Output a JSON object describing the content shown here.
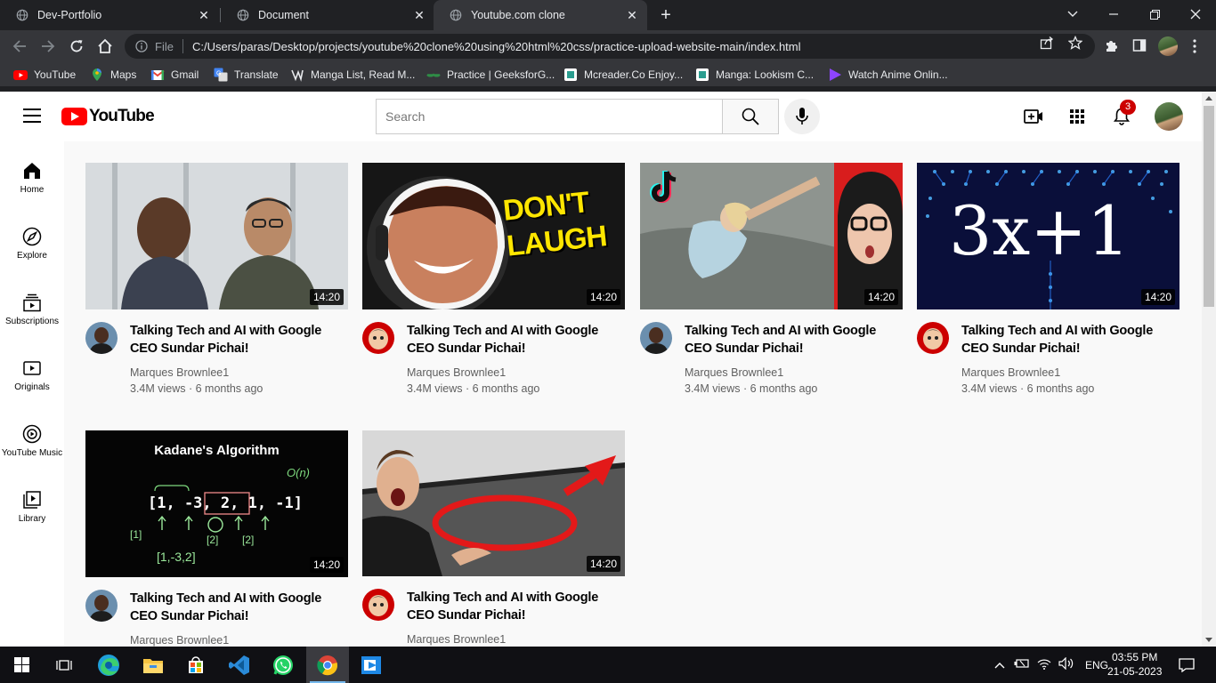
{
  "browser": {
    "tabs": [
      {
        "title": "Dev-Portfolio"
      },
      {
        "title": "Document"
      },
      {
        "title": "Youtube.com clone"
      }
    ],
    "url_label": "File",
    "url": "C:/Users/paras/Desktop/projects/youtube%20clone%20using%20html%20css/practice-upload-website-main/index.html",
    "bookmarks": [
      {
        "label": "YouTube",
        "icon": "youtube-icon"
      },
      {
        "label": "Maps",
        "icon": "maps-icon"
      },
      {
        "label": "Gmail",
        "icon": "gmail-icon"
      },
      {
        "label": "Translate",
        "icon": "translate-icon"
      },
      {
        "label": "Manga List, Read M...",
        "icon": "manga-icon"
      },
      {
        "label": "Practice | GeeksforG...",
        "icon": "gfg-icon"
      },
      {
        "label": "Mcreader.Co Enjoy...",
        "icon": "page-icon"
      },
      {
        "label": "Manga: Lookism C...",
        "icon": "page-icon"
      },
      {
        "label": "Watch Anime Onlin...",
        "icon": "anime-icon"
      }
    ]
  },
  "youtube": {
    "logo_text": "YouTube",
    "search_placeholder": "Search",
    "notification_count": "3",
    "sidebar": [
      {
        "label": "Home",
        "icon": "home-icon"
      },
      {
        "label": "Explore",
        "icon": "explore-icon"
      },
      {
        "label": "Subscriptions",
        "icon": "subscriptions-icon"
      },
      {
        "label": "Originals",
        "icon": "originals-icon"
      },
      {
        "label": "YouTube Music",
        "icon": "music-icon"
      },
      {
        "label": "Library",
        "icon": "library-icon"
      }
    ],
    "videos": [
      {
        "title": "Talking Tech and AI with Google CEO Sundar Pichai!",
        "channel": "Marques Brownlee1",
        "meta": "3.4M views · 6 months ago",
        "duration": "14:20"
      },
      {
        "title": "Talking Tech and AI with Google CEO Sundar Pichai!",
        "channel": "Marques Brownlee1",
        "meta": "3.4M views · 6 months ago",
        "duration": "14:20",
        "thumb_text": [
          "DON'T",
          "LAUGH"
        ]
      },
      {
        "title": "Talking Tech and AI with Google CEO Sundar Pichai!",
        "channel": "Marques Brownlee1",
        "meta": "3.4M views · 6 months ago",
        "duration": "14:20"
      },
      {
        "title": "Talking Tech and AI with Google CEO Sundar Pichai!",
        "channel": "Marques Brownlee1",
        "meta": "3.4M views · 6 months ago",
        "duration": "14:20",
        "thumb_text": [
          "3x+1"
        ]
      },
      {
        "title": "Talking Tech and AI with Google CEO Sundar Pichai!",
        "channel": "Marques Brownlee1",
        "meta": "",
        "duration": "14:20",
        "thumb_text": [
          "Kadane's Algorithm",
          "O(n)",
          "[1, -3, 2, 1, -1]",
          "[1]",
          "[2]",
          "[2]",
          "[1,-3,2]"
        ]
      },
      {
        "title": "Talking Tech and AI with Google CEO Sundar Pichai!",
        "channel": "Marques Brownlee1",
        "meta": "",
        "duration": "14:20"
      }
    ]
  },
  "taskbar": {
    "language": "ENG",
    "time": "03:55 PM",
    "date": "21-05-2023"
  }
}
